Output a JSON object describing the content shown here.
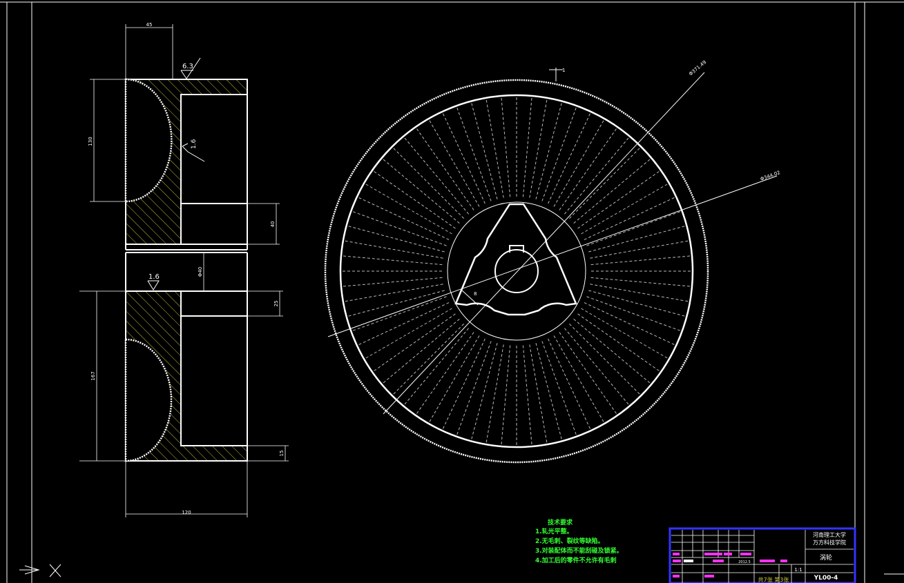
{
  "drawing": {
    "part_name": "涡轮",
    "drawing_no": "YL00-4",
    "scale": "1:1",
    "school_line1": "河南理工大学",
    "school_line2": "万方科技学院",
    "sheet_info": "共7张 第3张",
    "date": "2012.5"
  },
  "dimensions": {
    "top_width": "45",
    "bottom_width": "120",
    "upper_height": "130",
    "lower_height": "167",
    "bore_step": "40",
    "bore_dia": "Φ40",
    "key_step": "25",
    "bottom_step": "15",
    "roughness_top": "6.3",
    "roughness_mid": "1.6",
    "roughness_left": "1.6",
    "outer_dia": "Φ371.49",
    "root_dia": "Φ344.02",
    "angle_mark": "8",
    "top_mark": "1"
  },
  "tech_requirements": {
    "title": "技术要求",
    "items": [
      "1.轧光平整。",
      "2.无毛刺、裂纹等缺陷。",
      "3.对装配体而不能刮碰及锁紧。",
      "4.加工后的零件不允许有毛刺"
    ]
  },
  "colors": {
    "background": "#000000",
    "line": "#ffffff",
    "hatch": "#c8c03a",
    "text_green": "#33ff33",
    "title_border": "#3333ff",
    "magenta": "#ff33ff"
  }
}
